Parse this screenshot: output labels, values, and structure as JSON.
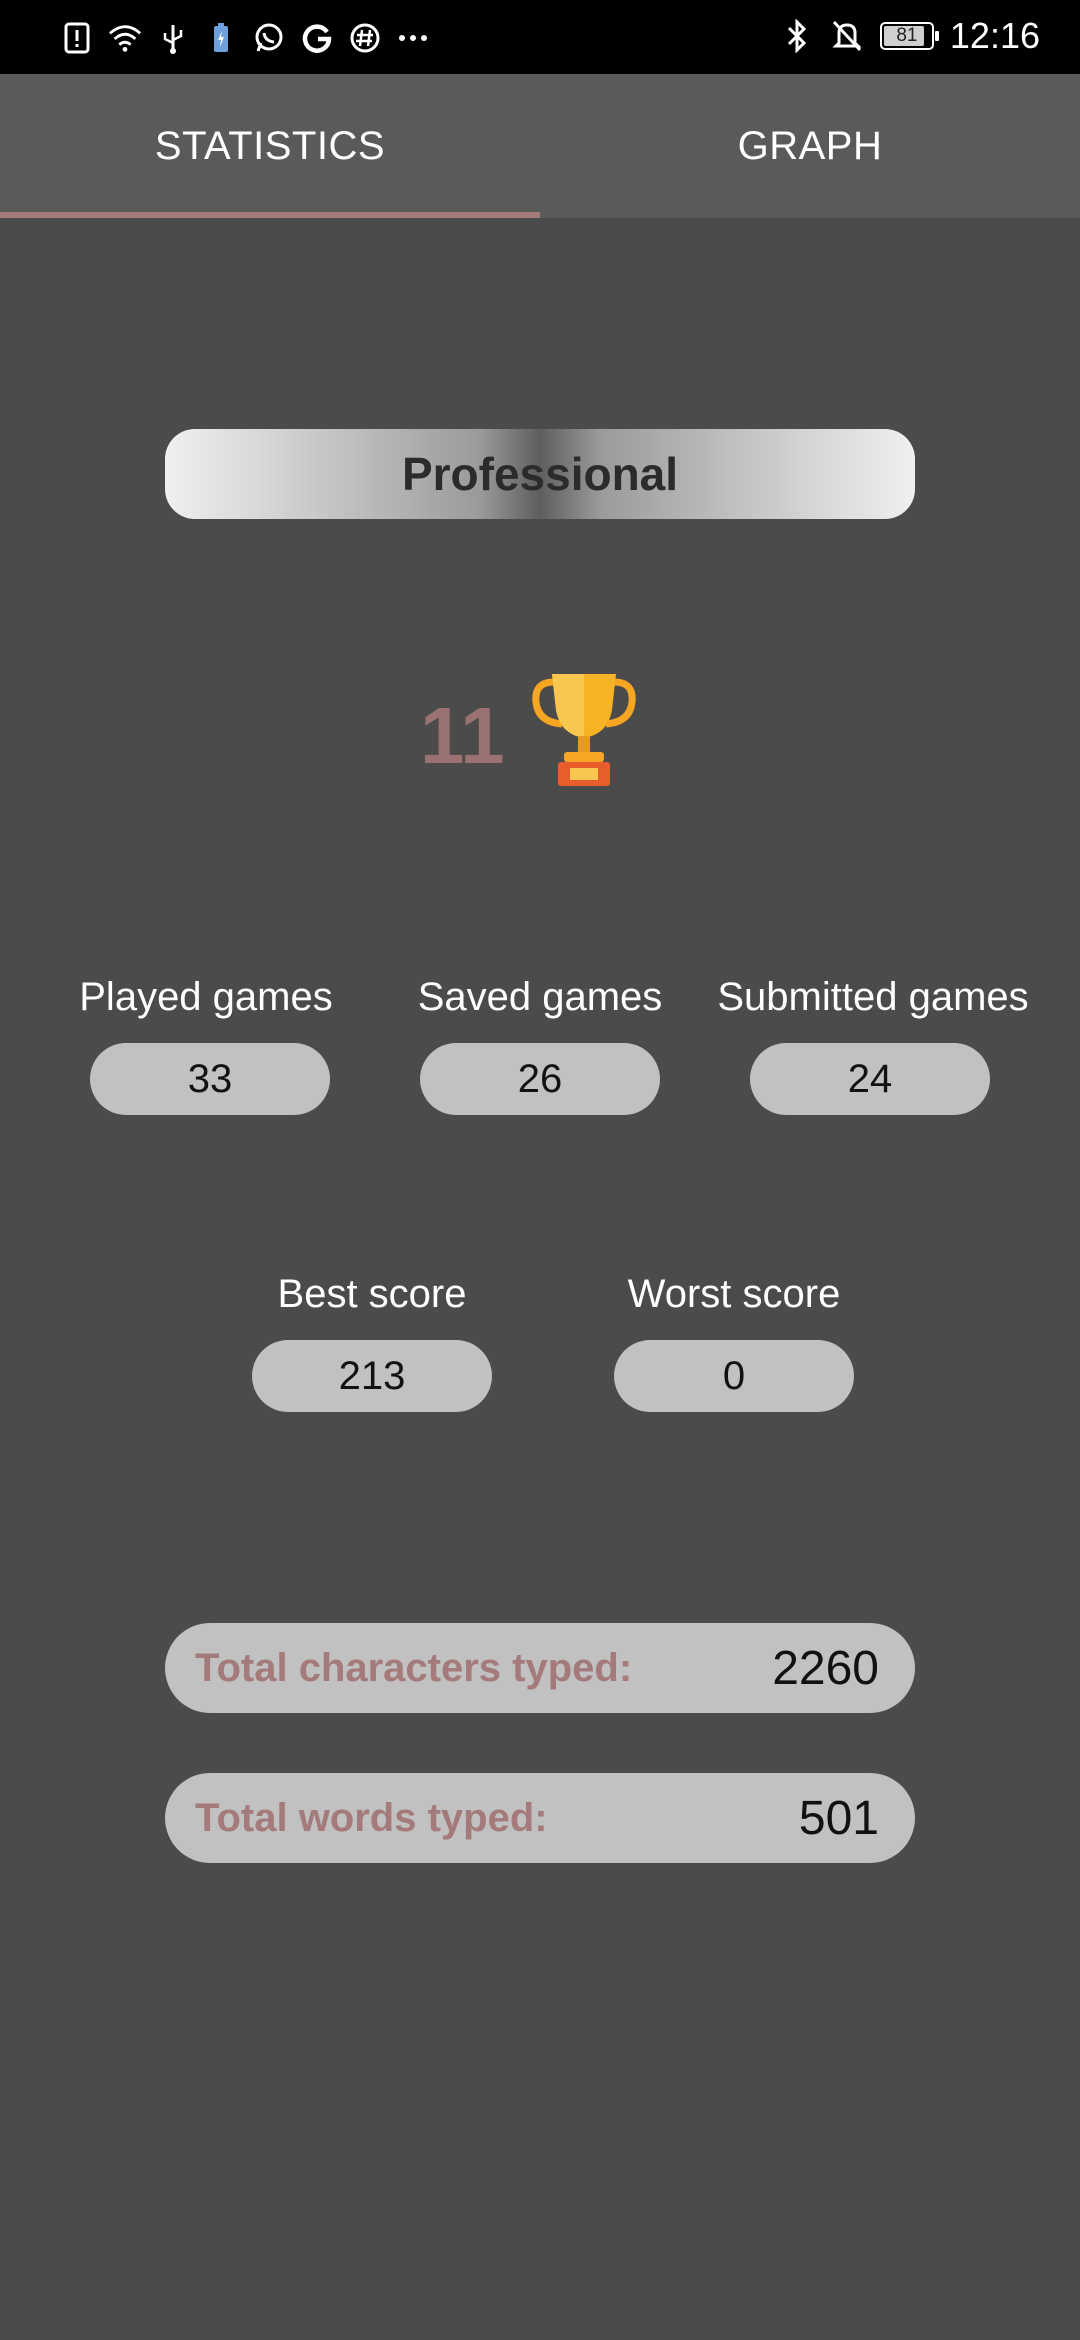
{
  "status_bar": {
    "time": "12:16",
    "battery": "81",
    "left_icons": [
      "alert-icon",
      "wifi-icon",
      "usb-icon",
      "battery-saver-icon",
      "whatsapp-icon",
      "google-icon",
      "hashtag-icon",
      "more-icon"
    ],
    "right_icons": [
      "bluetooth-icon",
      "mute-icon"
    ]
  },
  "tabs": [
    {
      "label": "STATISTICS",
      "active": true
    },
    {
      "label": "GRAPH",
      "active": false
    }
  ],
  "level": "Professional",
  "trophies": {
    "count": "11",
    "icon": "trophy-icon"
  },
  "stats_row1": [
    {
      "label": "Played games",
      "value": "33"
    },
    {
      "label": "Saved games",
      "value": "26"
    },
    {
      "label": "Submitted games",
      "value": "24"
    }
  ],
  "stats_row2": [
    {
      "label": "Best score",
      "value": "213"
    },
    {
      "label": "Worst score",
      "value": "0"
    }
  ],
  "totals": [
    {
      "label": "Total characters typed:",
      "value": "2260"
    },
    {
      "label": "Total words typed:",
      "value": "501"
    }
  ],
  "colors": {
    "background": "#4b4b4b",
    "tab_bar": "#5a5a5a",
    "accent": "#a47a7a",
    "pill": "#c1c1c1"
  }
}
